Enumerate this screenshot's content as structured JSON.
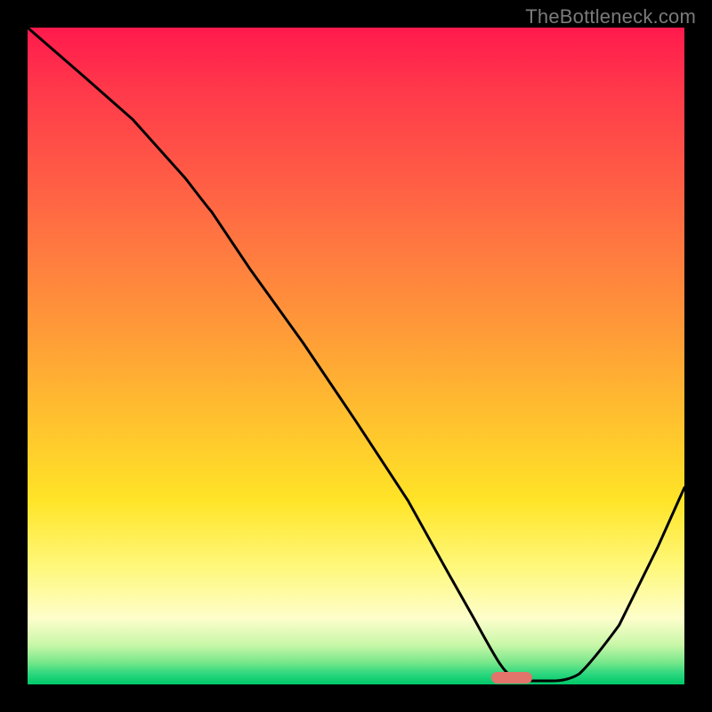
{
  "watermark": "TheBottleneck.com",
  "chart_data": {
    "type": "line",
    "title": "",
    "xlabel": "",
    "ylabel": "",
    "xlim": [
      0,
      100
    ],
    "ylim": [
      0,
      100
    ],
    "grid": false,
    "legend": false,
    "background": "red-to-green vertical gradient",
    "series": [
      {
        "name": "curve",
        "color": "#000000",
        "x": [
          0,
          8,
          16,
          24,
          28,
          34,
          42,
          50,
          58,
          64,
          68,
          72,
          76,
          80,
          84,
          90,
          96,
          100
        ],
        "y": [
          100,
          93,
          86,
          77,
          72,
          63,
          52,
          40,
          28,
          17,
          10,
          4,
          1,
          0,
          1,
          9,
          21,
          30
        ]
      }
    ],
    "marker": {
      "name": "optimal-range",
      "x_start": 72,
      "x_end": 78,
      "y": 0,
      "color": "#e2746c"
    },
    "gradient_stops": [
      {
        "pos": 0,
        "color": "#ff1a4d"
      },
      {
        "pos": 50,
        "color": "#ff9a38"
      },
      {
        "pos": 82,
        "color": "#fff87a"
      },
      {
        "pos": 100,
        "color": "#00c76a"
      }
    ]
  }
}
